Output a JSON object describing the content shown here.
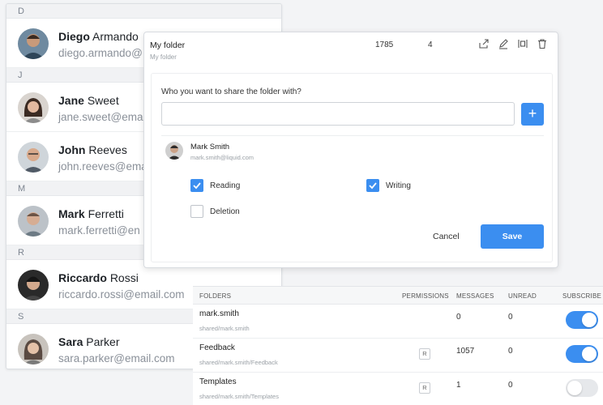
{
  "contacts": {
    "sections": [
      {
        "letter": "D",
        "people": [
          {
            "first": "Diego",
            "last": "Armando",
            "email": "diego.armando@..."
          }
        ]
      },
      {
        "letter": "J",
        "people": [
          {
            "first": "Jane",
            "last": "Sweet",
            "email": "jane.sweet@ema"
          },
          {
            "first": "John",
            "last": "Reeves",
            "email": "john.reeves@ema"
          }
        ]
      },
      {
        "letter": "M",
        "people": [
          {
            "first": "Mark",
            "last": "Ferretti",
            "email": "mark.ferretti@en"
          }
        ]
      },
      {
        "letter": "R",
        "people": [
          {
            "first": "Riccardo",
            "last": "Rossi",
            "email": "riccardo.rossi@email.com"
          }
        ]
      },
      {
        "letter": "S",
        "people": [
          {
            "first": "Sara",
            "last": "Parker",
            "email": "sara.parker@email.com"
          }
        ]
      }
    ]
  },
  "folder": {
    "title": "My folder",
    "subtitle": "My folder",
    "count1": "1785",
    "count2": "4",
    "icons": [
      "share-icon",
      "edit-icon",
      "columns-icon",
      "trash-icon"
    ]
  },
  "share": {
    "question": "Who you want to share the folder with?",
    "input_value": "",
    "add_label": "+",
    "user_name": "Mark Smith",
    "user_email": "mark.smith@liquid.com",
    "perm_reading": "Reading",
    "perm_writing": "Writing",
    "perm_deletion": "Deletion",
    "cancel_label": "Cancel",
    "save_label": "Save",
    "accent": "#3b8ef0"
  },
  "table": {
    "headers": {
      "folders": "FOLDERS",
      "permissions": "PERMISSIONS",
      "messages": "MESSAGES",
      "unread": "UNREAD",
      "subscribe": "SUBSCRIBE"
    },
    "rows": [
      {
        "name": "mark.smith",
        "path": "shared/mark.smith",
        "perm": "",
        "messages": "0",
        "unread": "0",
        "subscribed": true
      },
      {
        "name": "Feedback",
        "path": "shared/mark.smith/Feedback",
        "perm": "R",
        "messages": "1057",
        "unread": "0",
        "subscribed": true
      },
      {
        "name": "Templates",
        "path": "shared/mark.smith/Templates",
        "perm": "R",
        "messages": "1",
        "unread": "0",
        "subscribed": false
      }
    ]
  }
}
